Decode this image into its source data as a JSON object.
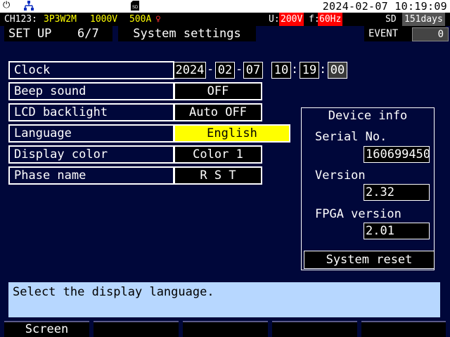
{
  "top_bar": {
    "datetime": "2024-02-07  10:19:09",
    "icons": [
      "plug-icon",
      "network-icon",
      "sd-card-icon"
    ]
  },
  "status_bar": {
    "channel": "CH123:",
    "wiring": "3P3W2M",
    "voltage": "1000V",
    "current": "500A",
    "u_label": "U:",
    "u_value": "200V",
    "f_label": "f:",
    "f_value": "60Hz",
    "sd_label": "SD",
    "sd_days": "151days"
  },
  "header": {
    "screen_title": "SET UP",
    "page": "6/7",
    "tab_title": "System settings",
    "event_label": "EVENT",
    "event_value": "0"
  },
  "settings": {
    "clock_label": "Clock",
    "clock": {
      "year": "2024",
      "month": "02",
      "day": "07",
      "hour": "10",
      "minute": "19",
      "second": "00",
      "date_sep": "-",
      "time_sep": ":"
    },
    "beep_label": "Beep sound",
    "beep_value": "OFF",
    "backlight_label": "LCD backlight",
    "backlight_value": "Auto OFF",
    "language_label": "Language",
    "language_value": "English",
    "color_label": "Display color",
    "color_value": "Color 1",
    "phase_label": "Phase name",
    "phase_value": "R S T"
  },
  "device_info": {
    "title": "Device info",
    "serial_label": "Serial No.",
    "serial_value": "160699450",
    "version_label": "Version",
    "version_value": "2.32",
    "fpga_label": "FPGA version",
    "fpga_value": "2.01",
    "reset_button": "System reset"
  },
  "message": "Select the display language.",
  "function_keys": [
    "Screen",
    "",
    "",
    "",
    ""
  ],
  "colors": {
    "background": "#00073a",
    "selected": "#ffff00",
    "alert": "#ff0000",
    "message_bg": "#b7d7ff"
  }
}
